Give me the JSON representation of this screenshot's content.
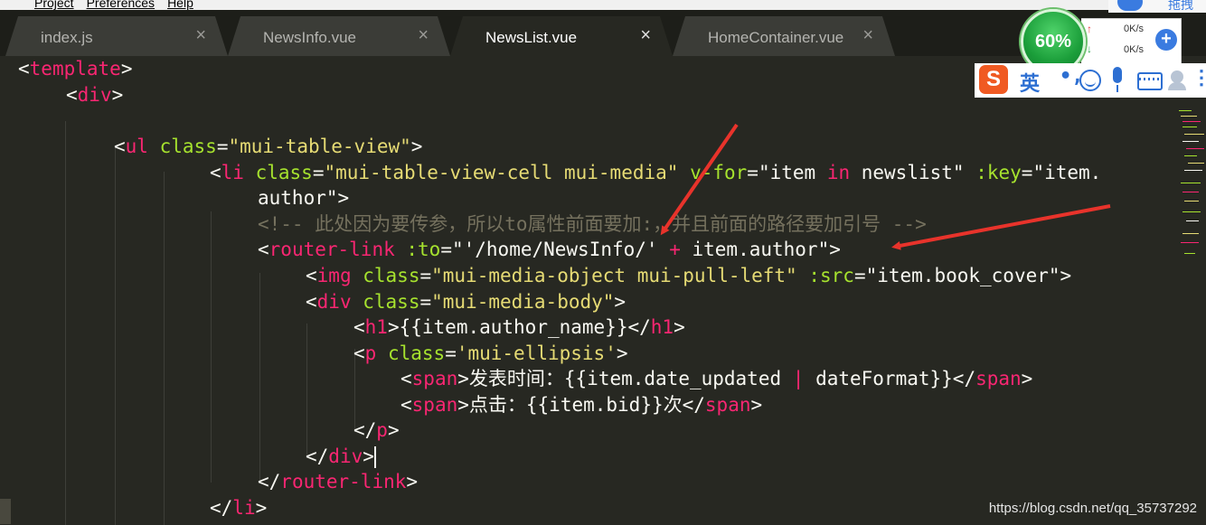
{
  "menu": [
    "Project",
    "Preferences",
    "Help"
  ],
  "tabs": [
    {
      "label": "index.js",
      "close": "×",
      "active": false
    },
    {
      "label": "NewsInfo.vue",
      "close": "×",
      "active": false
    },
    {
      "label": "NewsList.vue",
      "close": "×",
      "active": true
    },
    {
      "label": "HomeContainer.vue",
      "close": "×",
      "active": false
    }
  ],
  "code": {
    "l1": [
      "<",
      "template",
      ">"
    ],
    "l2": [
      "<",
      "div",
      ">"
    ],
    "l3": [
      "<",
      "ul",
      " ",
      "class",
      "=",
      "\"mui-table-view\"",
      ">"
    ],
    "l4": [
      "<",
      "li",
      " ",
      "class",
      "=",
      "\"mui-table-view-cell mui-media\"",
      " ",
      "v-for",
      "=",
      "\"item ",
      "in",
      " newslist\"",
      " ",
      ":key",
      "=",
      "\"item."
    ],
    "l5": [
      "author\"",
      ">"
    ],
    "l6": [
      "<!-- 此处因为要传参，所以to属性前面要加:，并且前面的路径要加引号 -->"
    ],
    "l7": [
      "<",
      "router-link",
      " ",
      ":to",
      "=",
      "\"'/home/NewsInfo/'",
      " + ",
      "item.author\"",
      ">"
    ],
    "l8": [
      "<",
      "img",
      " ",
      "class",
      "=",
      "\"mui-media-object mui-pull-left\"",
      " ",
      ":src",
      "=",
      "\"item.book_cover\"",
      ">"
    ],
    "l9": [
      "<",
      "div",
      " ",
      "class",
      "=",
      "\"mui-media-body\"",
      ">"
    ],
    "l10": [
      "<",
      "h1",
      ">",
      "{{item.author_name}}",
      "</",
      "h1",
      ">"
    ],
    "l11": [
      "<",
      "p",
      " ",
      "class",
      "=",
      "'mui-ellipsis'",
      ">"
    ],
    "l12": [
      "<",
      "span",
      ">",
      "发表时间：{{item.date_updated ",
      "|",
      " dateFormat}}",
      "</",
      "span",
      ">"
    ],
    "l13": [
      "<",
      "span",
      ">",
      "点击：{{item.bid}}次",
      "</",
      "span",
      ">"
    ],
    "l14": [
      "</",
      "p",
      ">"
    ],
    "l15": [
      "</",
      "div",
      ">"
    ],
    "l16": [
      "</",
      "router-link",
      ">"
    ],
    "l17": [
      "</",
      "li",
      ">"
    ]
  },
  "widget": {
    "percent": "60%",
    "up_arrow": "↑",
    "down_arrow": "↓",
    "upload": "0K/s",
    "download": "0K/s",
    "plus": "+"
  },
  "top_right": {
    "drag_label": "拖拽"
  },
  "ime": {
    "logo": "S",
    "lang": "英",
    "punct": "•,",
    "more": "⋮"
  },
  "watermark": "https://blog.csdn.net/qq_35737292",
  "colors": {
    "background": "#272822",
    "tag": "#f92672",
    "attribute": "#a6e22e",
    "string": "#e6db74",
    "comment": "#75715e",
    "arrow": "#e8332b"
  }
}
